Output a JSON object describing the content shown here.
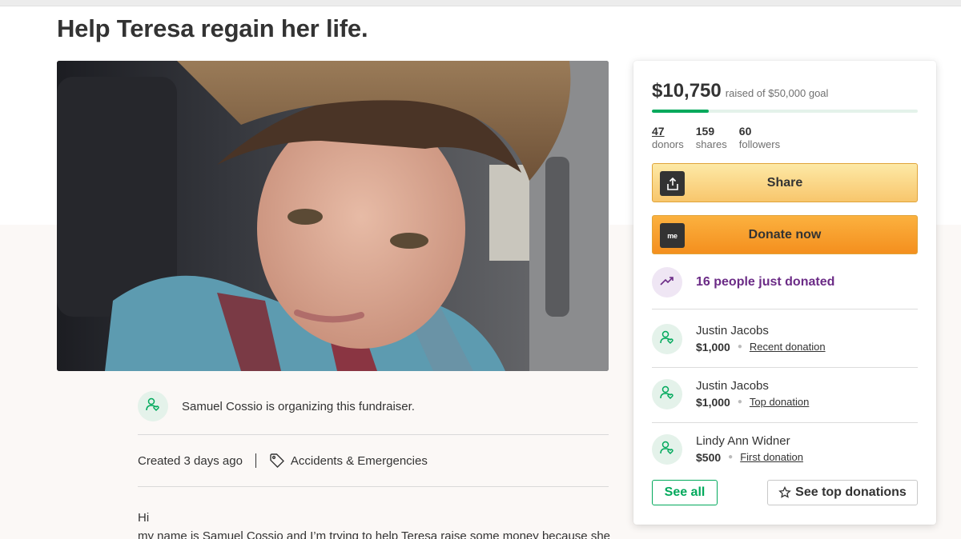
{
  "campaign": {
    "title": "Help Teresa regain her life.",
    "organizer_text": "Samuel Cossio is organizing this fundraiser.",
    "created": "Created 3 days ago",
    "category": "Accidents & Emergencies",
    "story_line1": "Hi",
    "story_line2": "my name is Samuel Cossio and I’m trying to help Teresa raise some money because she"
  },
  "donation": {
    "raised": "$10,750",
    "goal_text": "raised of $50,000 goal",
    "progress_fraction": 0.215,
    "stats": [
      {
        "num": "47",
        "label": "donors"
      },
      {
        "num": "159",
        "label": "shares"
      },
      {
        "num": "60",
        "label": "followers"
      }
    ],
    "share_label": "Share",
    "donate_label": "Donate now",
    "donate_icon_text": "me",
    "trend_text": "16 people just donated",
    "donors": [
      {
        "name": "Justin Jacobs",
        "amount": "$1,000",
        "type": "Recent donation"
      },
      {
        "name": "Justin Jacobs",
        "amount": "$1,000",
        "type": "Top donation"
      },
      {
        "name": "Lindy Ann Widner",
        "amount": "$500",
        "type": "First donation"
      }
    ],
    "see_all_label": "See all",
    "see_top_label": "See top donations"
  },
  "colors": {
    "accent_green": "#02a95c",
    "trend_purple": "#6b2b86",
    "donate_orange": "#f48f1e",
    "share_yellow": "#f8c66c"
  },
  "icons": {
    "share": "share-icon",
    "donate": "gofundme-logo-icon",
    "trend": "trending-up-icon",
    "organizer": "person-heart-icon",
    "category": "tag-icon",
    "see_top": "star-icon"
  }
}
